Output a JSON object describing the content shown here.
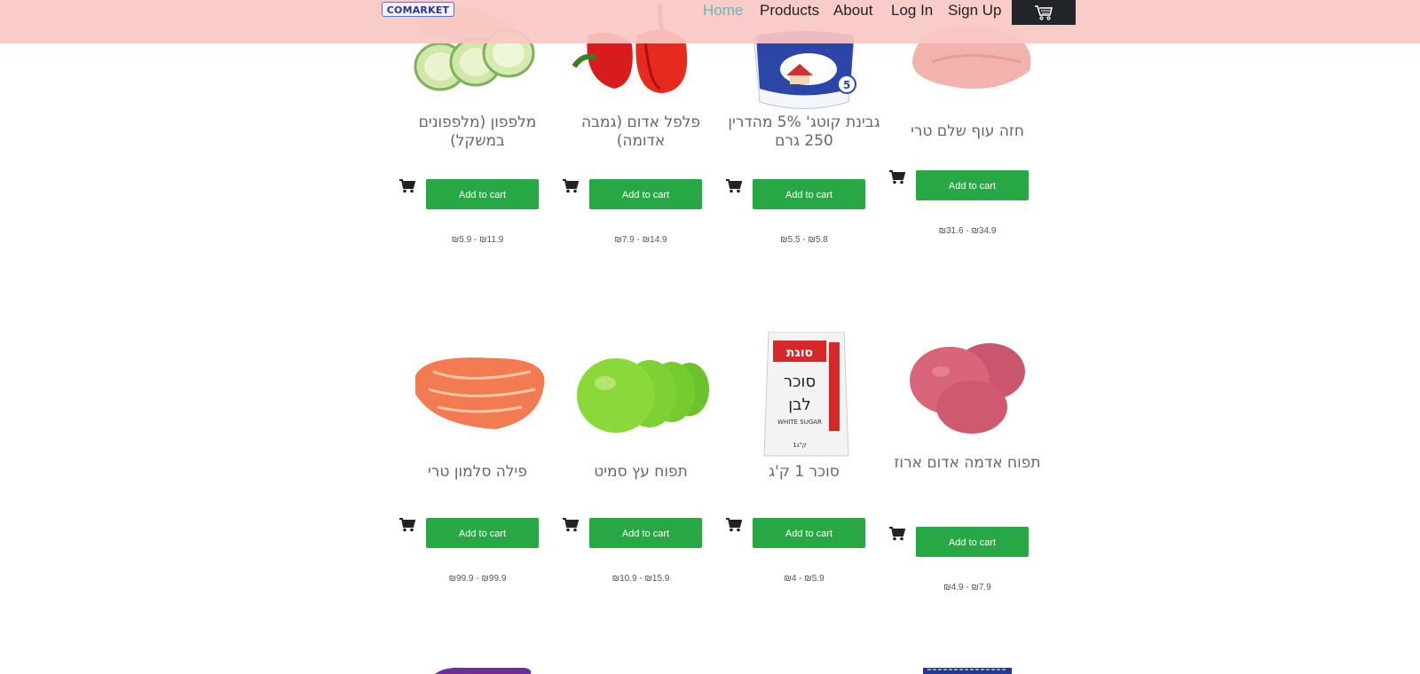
{
  "nav": {
    "brand": "COMARKET",
    "links": [
      "Home",
      "Products",
      "About",
      "Log In",
      "Sign Up"
    ],
    "active": "Home",
    "cart_icon": "shopping-cart-icon"
  },
  "colors": {
    "navbar_bg": "#fac8c4",
    "active_link": "#6ab7bb",
    "add_button": "#28a745",
    "cart_button": "#212529"
  },
  "products": [
    {
      "name": "מלפפון (מלפפונים במשקל)",
      "price": "₪5.9 - ₪11.9",
      "button": "Add to cart",
      "image": "cucumber-image"
    },
    {
      "name": "פלפל אדום (גמבה אדומה)",
      "price": "₪7.9 - ₪14.9",
      "button": "Add to cart",
      "image": "red-pepper-image"
    },
    {
      "name": "גבינת קוטג' 5% מהדרין 250 גרם",
      "price": "₪5.5 - ₪5.8",
      "button": "Add to cart",
      "image": "cottage-cheese-image"
    },
    {
      "name": "חזה עוף שלם טרי",
      "price": "₪31.6 - ₪34.9",
      "button": "Add to cart",
      "image": "chicken-breast-image"
    },
    {
      "name": "פילה סלמון טרי",
      "price": "₪99.9 - ₪99.9",
      "button": "Add to cart",
      "image": "salmon-fillet-image"
    },
    {
      "name": "תפוח עץ סמיט",
      "price": "₪10.9 - ₪15.9",
      "button": "Add to cart",
      "image": "green-apples-image"
    },
    {
      "name": "סוכר 1 ק'ג",
      "price": "₪4 - ₪5.9",
      "button": "Add to cart",
      "image": "sugar-bag-image",
      "package": {
        "brand": "סוגת",
        "line1": "סוכר",
        "line2": "לבן",
        "en": "WHITE SUGAR",
        "weight": "1ק\"ג"
      }
    },
    {
      "name": "תפוח אדמה אדום ארוז",
      "price": "₪4.9 - ₪7.9",
      "button": "Add to cart",
      "image": "red-potatoes-image"
    }
  ]
}
